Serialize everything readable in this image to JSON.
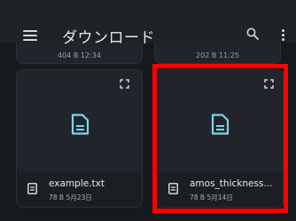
{
  "appbar": {
    "title": "ダウンロード",
    "menu_icon": "menu-icon",
    "search_icon": "search-icon",
    "more_icon": "more-vert-icon"
  },
  "top_row": [
    {
      "meta": "404 B 12:34"
    },
    {
      "meta": "202 B 11:25"
    }
  ],
  "files": [
    {
      "name": "example.txt",
      "meta": "78 B 5月23日",
      "thumb_icon": "document-icon",
      "expand_icon": "expand-icon"
    },
    {
      "name": "amos_thickness...",
      "meta": "78 B 5月14日",
      "thumb_icon": "document-icon",
      "expand_icon": "expand-icon"
    }
  ],
  "colors": {
    "accent": "#7fd3ea",
    "highlight": "#ff0000",
    "background": "#16191d"
  }
}
